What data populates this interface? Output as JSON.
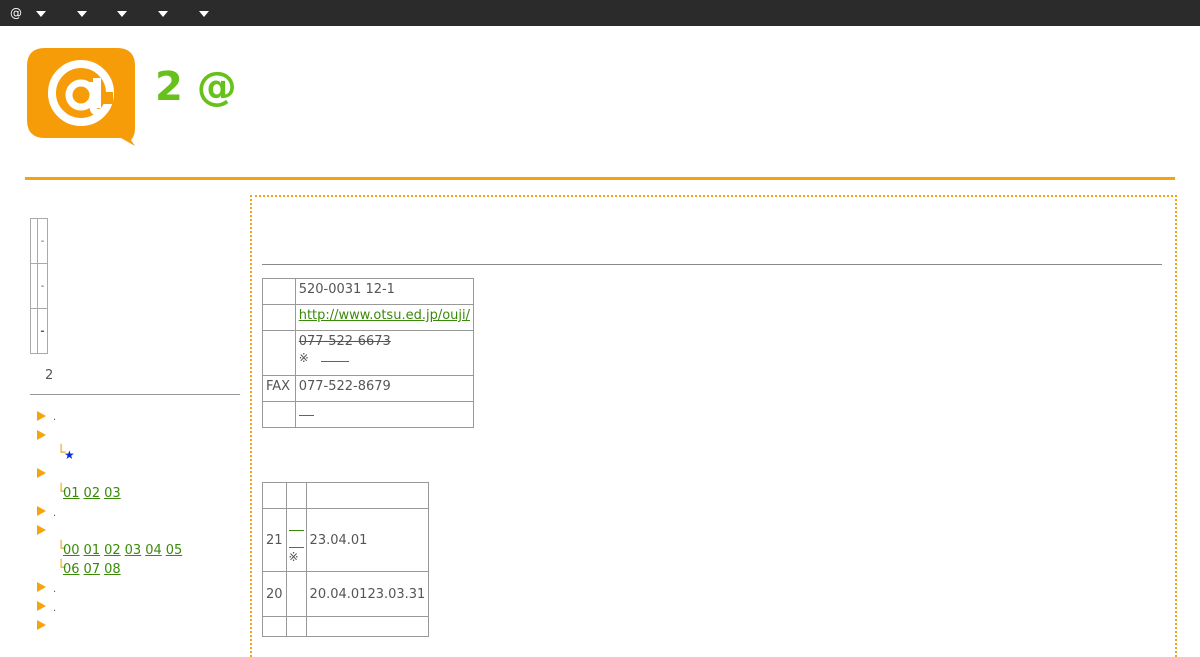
{
  "menu": {
    "items": [
      {
        "label": "@"
      },
      {
        "label": ""
      },
      {
        "label": ""
      },
      {
        "label": ""
      },
      {
        "label": ""
      },
      {
        "label": ""
      }
    ]
  },
  "header": {
    "logo_icon": "at-speech-bubble-icon",
    "title": "2 @",
    "accent_color": "#f5a50b",
    "title_color": "#66c21b"
  },
  "sidebar": {
    "mini_table": [
      "-",
      "-",
      "-"
    ],
    "page_number": "2",
    "nav": {
      "year_links_a": [
        "01",
        "02",
        "03"
      ],
      "year_links_b": [
        "00",
        "01",
        "02",
        "03",
        "04",
        "05"
      ],
      "year_links_c": [
        "06",
        "07",
        "08"
      ],
      "star": "★"
    }
  },
  "school_info": {
    "address": "520-0031 12-1",
    "url": "http://www.otsu.ed.jp/ouji/",
    "tel": "077-522-6673",
    "tel_note": "※",
    "fax_label": "FAX",
    "fax": "077-522-8679"
  },
  "history": {
    "rows": [
      {
        "term": "21",
        "note": "※",
        "date": "23.04.01"
      },
      {
        "term": "20",
        "note": "",
        "date": "20.04.0123.03.31"
      }
    ]
  }
}
